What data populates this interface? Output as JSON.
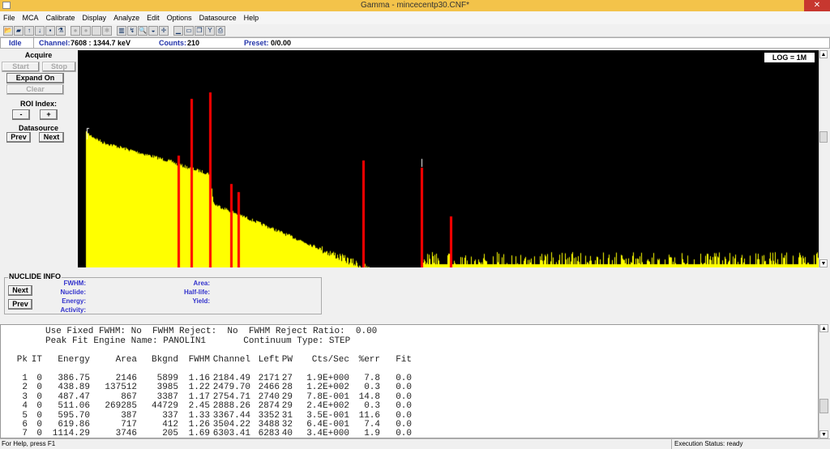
{
  "window": {
    "title": "Gamma - mincecentp30.CNF*",
    "close": "✕"
  },
  "menu": [
    "File",
    "MCA",
    "Calibrate",
    "Display",
    "Analyze",
    "Edit",
    "Options",
    "Datasource",
    "Help"
  ],
  "toolbar": [
    {
      "icon": "open-folder-icon",
      "g": "📂",
      "enabled": true
    },
    {
      "icon": "new-folder-icon",
      "g": "▰",
      "enabled": true
    },
    {
      "icon": "upload-icon",
      "g": "↑",
      "enabled": true
    },
    {
      "icon": "download-icon",
      "g": "↓",
      "enabled": true
    },
    {
      "icon": "save-icon",
      "g": "▪",
      "enabled": true
    },
    {
      "icon": "flask-icon",
      "g": "⚗",
      "enabled": true
    },
    {
      "sep": true
    },
    {
      "icon": "record-icon",
      "g": "●",
      "enabled": false
    },
    {
      "icon": "stop-record-icon",
      "g": "●",
      "enabled": false
    },
    {
      "icon": "blank-icon",
      "g": "",
      "enabled": false
    },
    {
      "icon": "detector-icon",
      "g": "✱",
      "enabled": false
    },
    {
      "sep": true
    },
    {
      "icon": "bar-chart-icon",
      "g": "▥",
      "enabled": true
    },
    {
      "icon": "spectrum-icon",
      "g": "↯",
      "enabled": true
    },
    {
      "icon": "zoom-icon",
      "g": "🔍",
      "enabled": true
    },
    {
      "icon": "pan-icon",
      "g": "◒",
      "enabled": true
    },
    {
      "icon": "crosshair-icon",
      "g": "✛",
      "enabled": true
    },
    {
      "sep": true
    },
    {
      "icon": "minimize-window-icon",
      "g": "▁",
      "enabled": true
    },
    {
      "icon": "maximize-window-icon",
      "g": "▭",
      "enabled": true
    },
    {
      "icon": "restore-window-icon",
      "g": "❐",
      "enabled": true
    },
    {
      "icon": "tools-icon",
      "g": "Y",
      "enabled": true
    },
    {
      "icon": "print-icon",
      "g": "⎙",
      "enabled": true
    }
  ],
  "status": {
    "state": "Idle",
    "channel_label": "Channel:",
    "channel_value": "7608  :  1344.7 keV",
    "counts_label": "Counts:",
    "counts_value": "210",
    "preset_label": "Preset:",
    "preset_value": "0/0.00"
  },
  "left": {
    "acquire": "Acquire",
    "start": "Start",
    "stop": "Stop",
    "expand": "Expand On",
    "clear": "Clear",
    "roi": "ROI Index:",
    "minus": "-",
    "plus": "+",
    "datasource": "Datasource",
    "prev": "Prev",
    "next": "Next"
  },
  "spectrum": {
    "scale": "LOG = 1M",
    "fill_color": "#ffff00",
    "roi_color": "#ff0000",
    "background": "#000000"
  },
  "nuclide": {
    "title": "NUCLIDE INFO",
    "next": "Next",
    "prev": "Prev",
    "fwhm": "FWHM:",
    "nuclide": "Nuclide:",
    "energy": "Energy:",
    "activity": "Activity:",
    "area": "Area:",
    "halflife": "Half-life:",
    "yield": "Yield:"
  },
  "report": {
    "line1": "Use Fixed FWHM: No  FWHM Reject:  No  FWHM Reject Ratio:  0.00",
    "line2": "Peak Fit Engine Name: PANOLIN1       Continuum Type: STEP",
    "columns": [
      "Pk",
      "IT",
      "Energy",
      "Area",
      "Bkgnd",
      "FWHM",
      "Channel",
      "Left",
      "PW",
      "Cts/Sec",
      "%err",
      "Fit"
    ],
    "rows": [
      [
        "1",
        "0",
        "386.75",
        "2146",
        "5899",
        "1.16",
        "2184.49",
        "2171",
        "27",
        "1.9E+000",
        "7.8",
        "0.0"
      ],
      [
        "2",
        "0",
        "438.89",
        "137512",
        "3985",
        "1.22",
        "2479.70",
        "2466",
        "28",
        "1.2E+002",
        "0.3",
        "0.0"
      ],
      [
        "3",
        "0",
        "487.47",
        "867",
        "3387",
        "1.17",
        "2754.71",
        "2740",
        "29",
        "7.8E-001",
        "14.8",
        "0.0"
      ],
      [
        "4",
        "0",
        "511.06",
        "269285",
        "44729",
        "2.45",
        "2888.26",
        "2874",
        "29",
        "2.4E+002",
        "0.3",
        "0.0"
      ],
      [
        "5",
        "0",
        "595.70",
        "387",
        "337",
        "1.33",
        "3367.44",
        "3352",
        "31",
        "3.5E-001",
        "11.6",
        "0.0"
      ],
      [
        "6",
        "0",
        "619.86",
        "717",
        "412",
        "1.26",
        "3504.22",
        "3488",
        "32",
        "6.4E-001",
        "7.4",
        "0.0"
      ],
      [
        "7",
        "0",
        "1114.29",
        "3746",
        "205",
        "1.69",
        "6303.41",
        "6283",
        "40",
        "3.4E+000",
        "1.9",
        "0.0"
      ]
    ]
  },
  "statusbar": {
    "help": "For Help, press F1",
    "exec": "Execution Status: ready"
  }
}
